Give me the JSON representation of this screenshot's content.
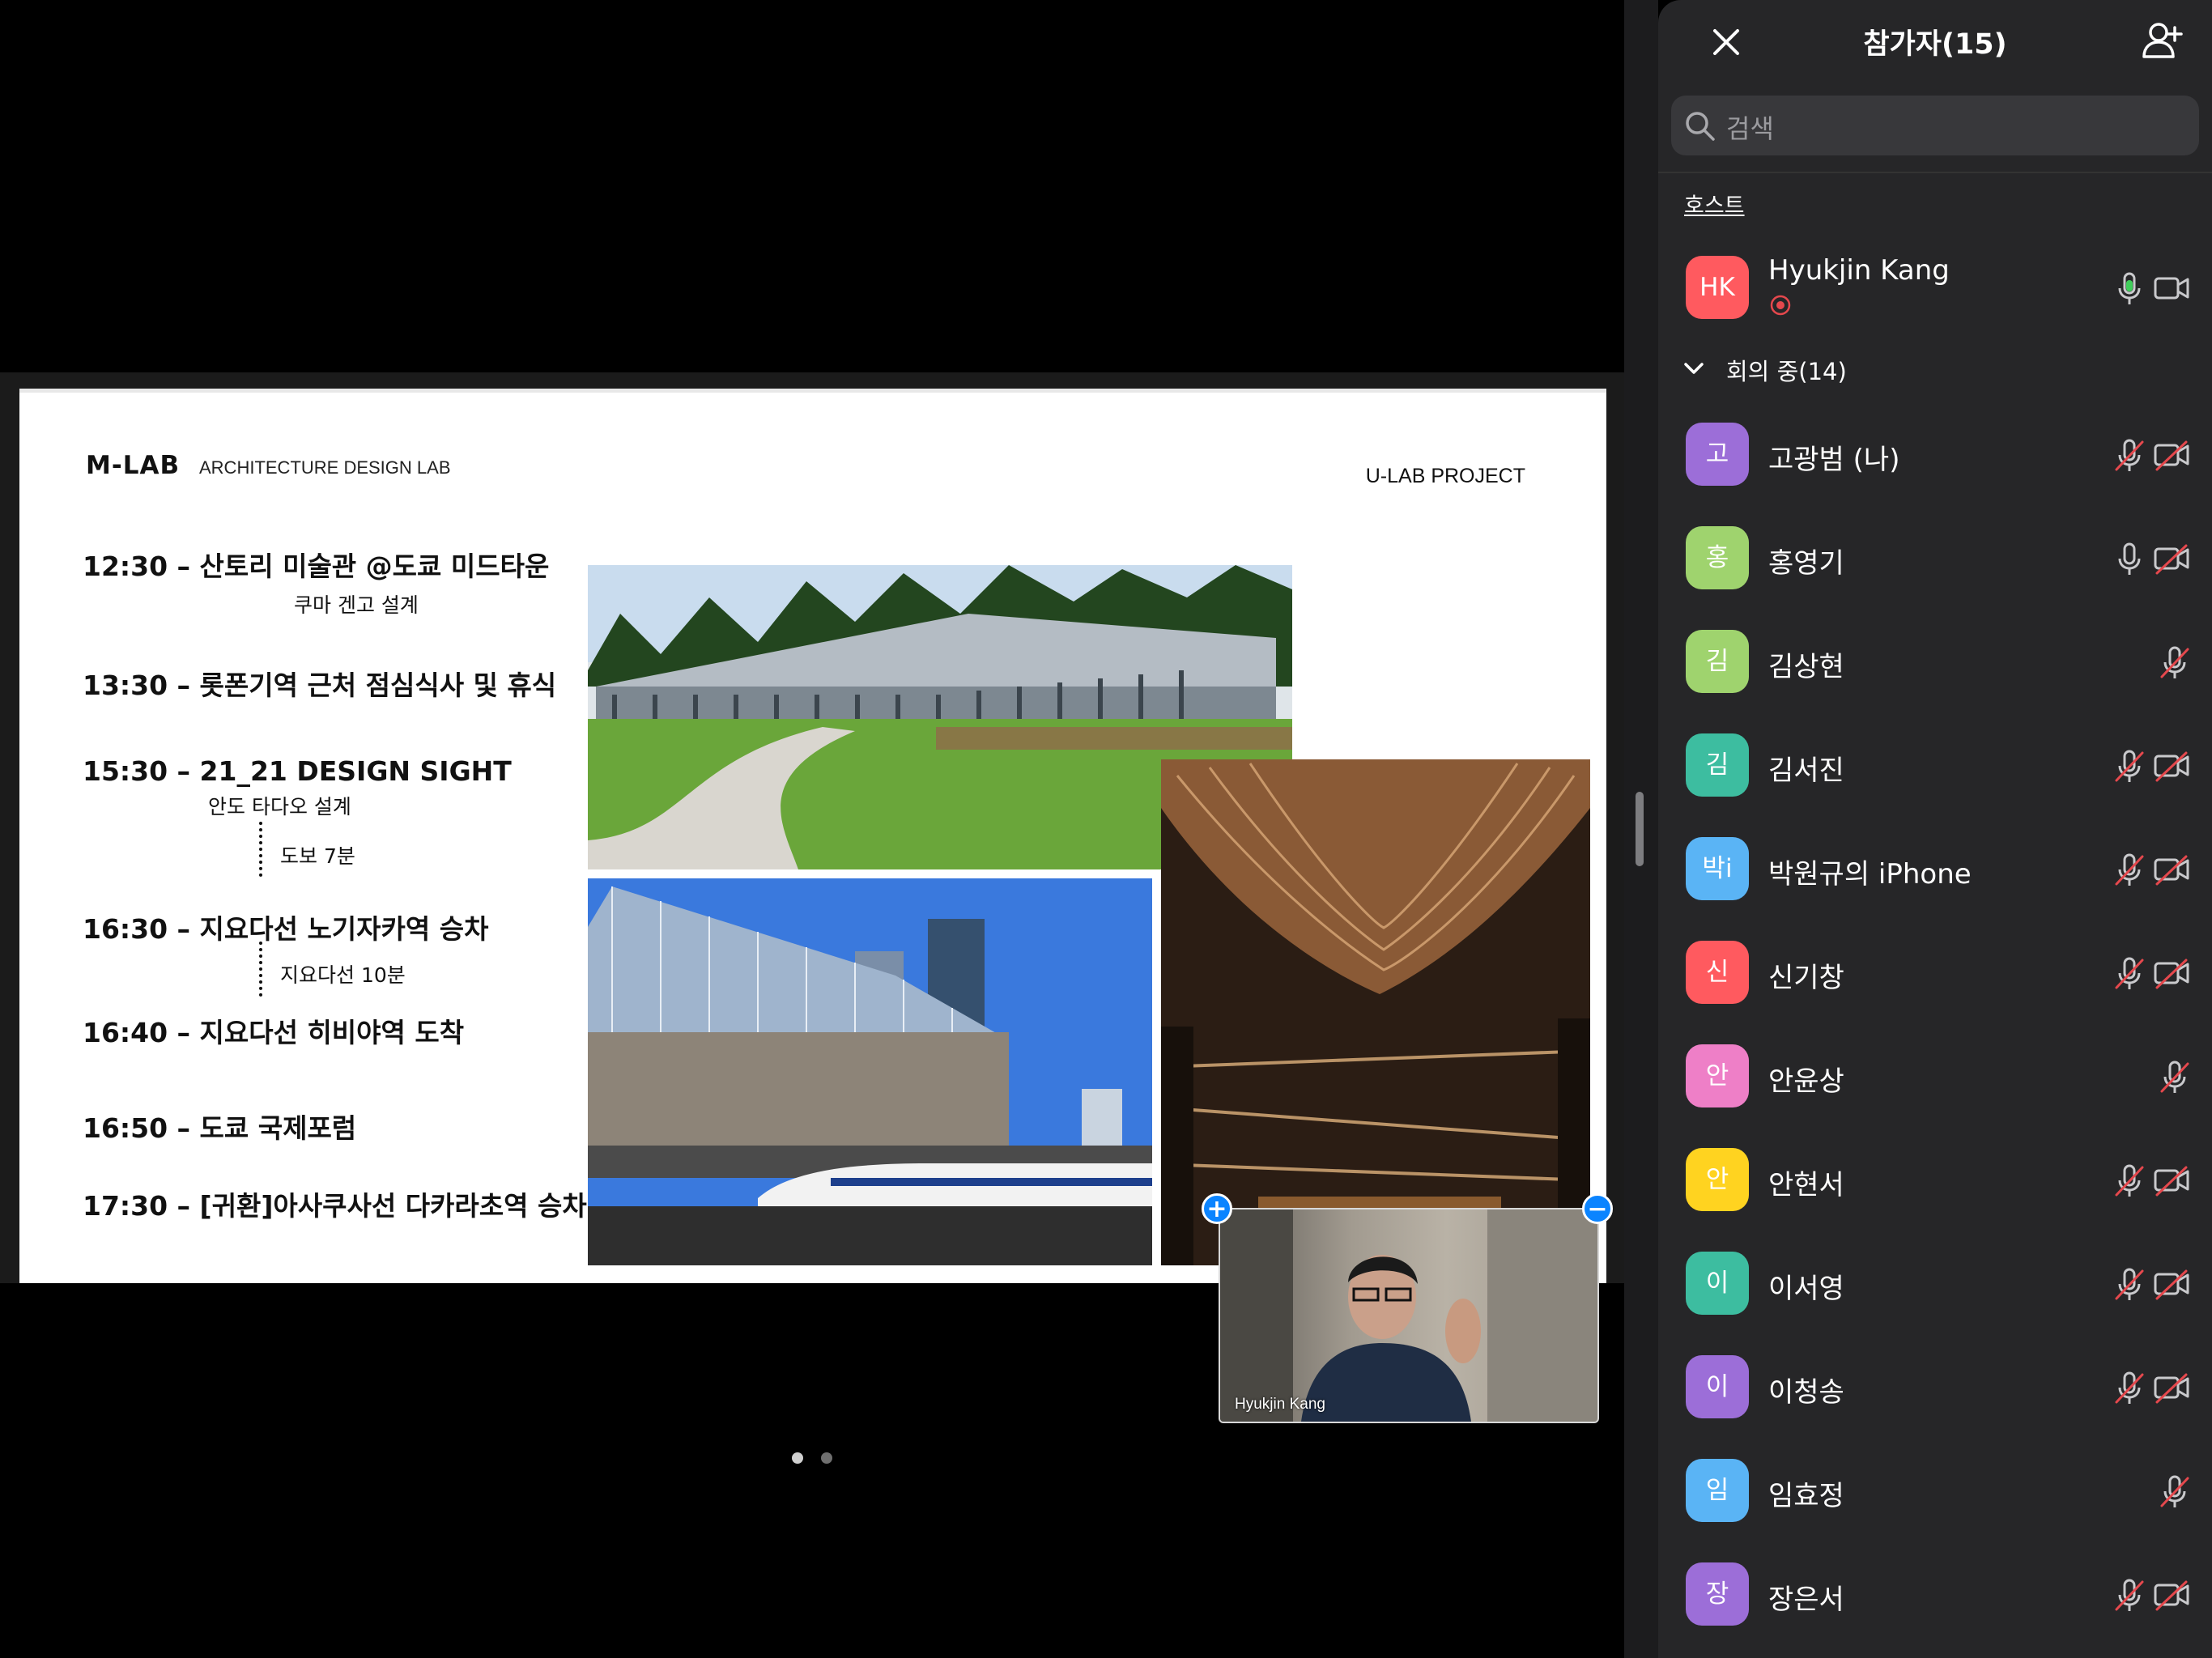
{
  "slide": {
    "brand": "M-LAB",
    "brand_sub": "ARCHITECTURE DESIGN LAB",
    "project": "U-LAB PROJECT",
    "schedule": [
      "12:30 – 산토리 미술관 @도쿄 미드타운",
      "13:30 – 롯폰기역 근처 점심식사 및 휴식",
      "15:30 – 21_21 DESIGN SIGHT",
      "16:30 – 지요다선 노기자카역 승차",
      "16:40 – 지요다선 히비야역 도착",
      "16:50 – 도쿄 국제포럼",
      "17:30 – [귀환]아사쿠사선 다카라초역 승차"
    ],
    "notes": {
      "suntory_designer": "쿠마 겐고 설계",
      "design_sight_designer": "안도 타다오 설계",
      "walk": "도보 7분",
      "subway": "지요다선 10분"
    }
  },
  "video": {
    "name": "Hyukjin Kang"
  },
  "pager": {
    "count": 2,
    "active": 0
  },
  "panel": {
    "title": "참가자(15)",
    "search_placeholder": "검색",
    "host_section": "호스트",
    "host": {
      "initials": "HK",
      "name": "Hyukjin Kang",
      "color": "#ff5a5f"
    },
    "meeting_section": "회의 중(14)",
    "participants": [
      {
        "initial": "고",
        "name": "고광범 (나)",
        "color": "#9c6ed8",
        "mic": "muted",
        "cam": "off"
      },
      {
        "initial": "홍",
        "name": "홍영기",
        "color": "#9fd36e",
        "mic": "on",
        "cam": "off"
      },
      {
        "initial": "김",
        "name": "김상현",
        "color": "#9fd36e",
        "mic": "muted",
        "cam": "none"
      },
      {
        "initial": "김",
        "name": "김서진",
        "color": "#3dbda0",
        "mic": "muted",
        "cam": "off"
      },
      {
        "initial": "박i",
        "name": "박원규의 iPhone",
        "color": "#5ab4f5",
        "mic": "muted",
        "cam": "off"
      },
      {
        "initial": "신",
        "name": "신기창",
        "color": "#ff5a5f",
        "mic": "muted",
        "cam": "off"
      },
      {
        "initial": "안",
        "name": "안윤상",
        "color": "#ee7fc7",
        "mic": "muted",
        "cam": "none"
      },
      {
        "initial": "안",
        "name": "안현서",
        "color": "#ffd320",
        "mic": "muted",
        "cam": "off"
      },
      {
        "initial": "이",
        "name": "이서영",
        "color": "#3dbda0",
        "mic": "muted",
        "cam": "off"
      },
      {
        "initial": "이",
        "name": "이청송",
        "color": "#9c6ed8",
        "mic": "muted",
        "cam": "off"
      },
      {
        "initial": "임",
        "name": "임효정",
        "color": "#5ab4f5",
        "mic": "muted",
        "cam": "none"
      },
      {
        "initial": "장",
        "name": "장은서",
        "color": "#9c6ed8",
        "mic": "muted",
        "cam": "off"
      }
    ]
  },
  "colors": {
    "accent": "#0b84ff",
    "panel_bg": "#262628",
    "mute_red": "#e5484d"
  }
}
